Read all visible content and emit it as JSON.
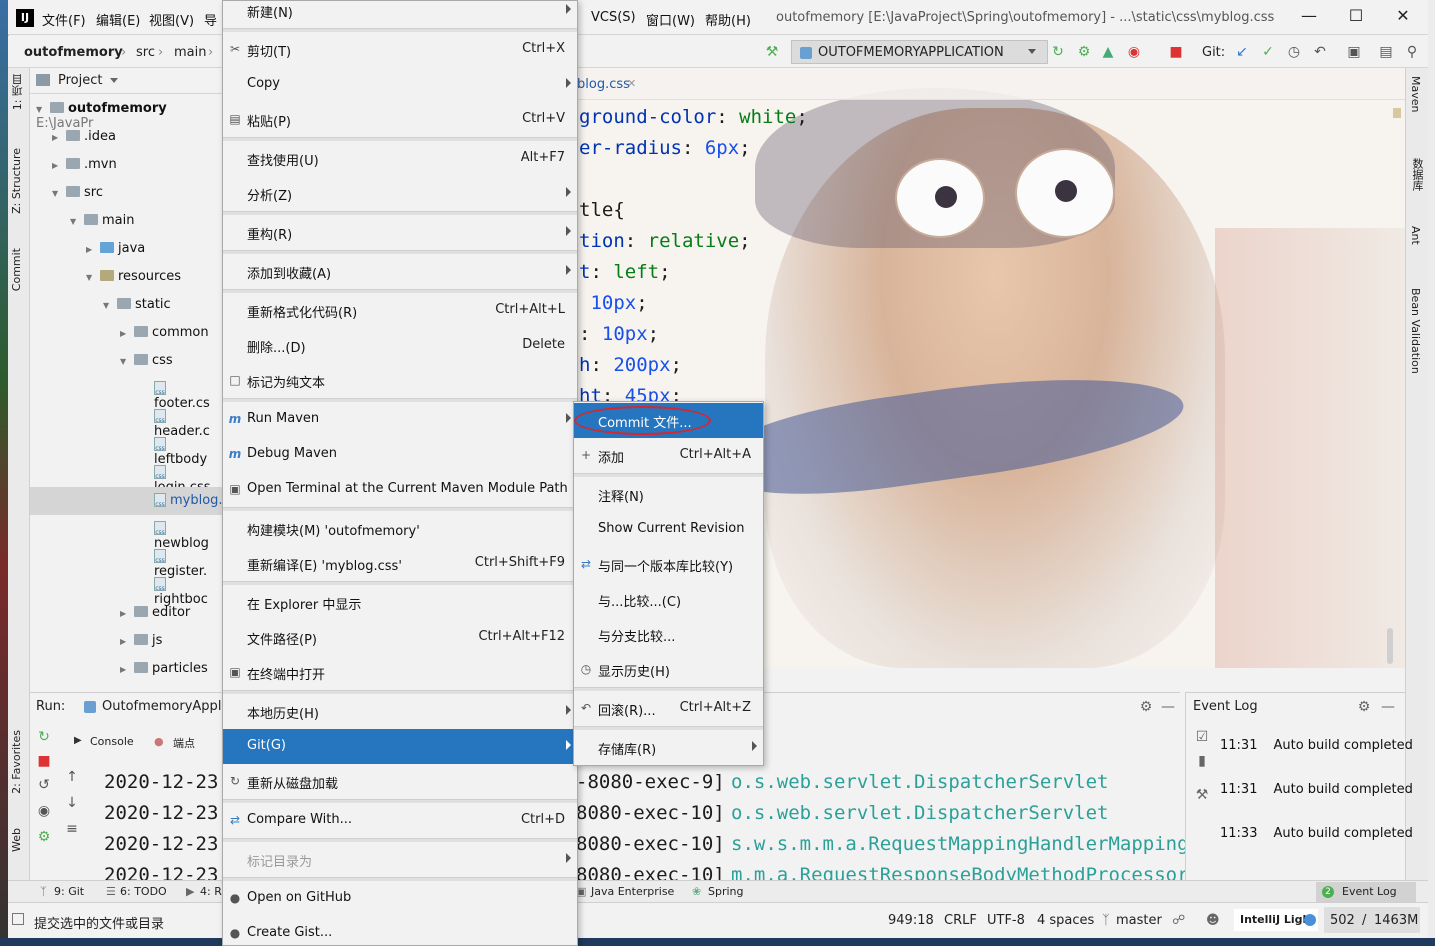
{
  "menubar": {
    "items": [
      "文件(F)",
      "编辑(E)",
      "视图(V)",
      "导",
      "VCS(S)",
      "窗口(W)",
      "帮助(H)"
    ],
    "window_title": "outofmemory [E:\\JavaProject\\Spring\\outofmemory] - ...\\static\\css\\myblog.css"
  },
  "breadcrumb": [
    "outofmemory",
    "src",
    "main"
  ],
  "run_config": "OUTOFMEMORYAPPLICATION",
  "git_label": "Git:",
  "left_tabs": [
    "1: 项目",
    "Z: Structure",
    "Commit",
    "2: Favorites",
    "Web"
  ],
  "right_tabs": [
    "Maven",
    "数据库",
    "Ant",
    "Bean Validation"
  ],
  "project": {
    "header": "Project",
    "root": "outofmemory",
    "root_path": "E:\\JavaPr",
    "tree": [
      ".idea",
      ".mvn",
      "src",
      "main",
      "java",
      "resources",
      "static",
      "common",
      "css",
      "footer.cs",
      "header.c",
      "leftbody",
      "login.css",
      "myblog.",
      "newblog",
      "register.",
      "rightboc",
      "editor",
      "js",
      "particles"
    ]
  },
  "editor": {
    "tab_label": "blog.css",
    "lines": [
      {
        "prop": "ground-color",
        "sep": ": ",
        "val": "white",
        "end": ";"
      },
      {
        "prop": "er-radius",
        "sep": ": ",
        "val": "6px",
        "end": ";"
      },
      {
        "prop": "",
        "sep": "",
        "val": "",
        "end": ""
      },
      {
        "prop": "tle{",
        "sep": "",
        "val": "",
        "end": ""
      },
      {
        "prop": "tion",
        "sep": ": ",
        "val": "relative",
        "end": ";"
      },
      {
        "prop": "t",
        "sep": ": ",
        "val": "left",
        "end": ";"
      },
      {
        "prop": "",
        "sep": " ",
        "val": "10px",
        "end": ";"
      },
      {
        "prop": "",
        "sep": ": ",
        "val": "10px",
        "end": ";"
      },
      {
        "prop": "h",
        "sep": ": ",
        "val": "200px",
        "end": ";"
      },
      {
        "prop": "ht",
        "sep": ": ",
        "val": "45px",
        "end": ";"
      }
    ]
  },
  "run_panel": {
    "label": "Run:",
    "config": "OutofmemoryAppli",
    "tabs": [
      "Console",
      "端点"
    ],
    "dates": [
      "2020-12-23",
      "2020-12-23",
      "2020-12-23",
      "2020-12-23"
    ],
    "threads": [
      "-8080-exec-9]",
      "8080-exec-10]",
      "8080-exec-10]",
      "8080-exec-10]"
    ],
    "classes": [
      "o.s.web.servlet.DispatcherServlet",
      "o.s.web.servlet.DispatcherServlet",
      "s.w.s.m.m.a.RequestMappingHandlerMapping",
      "m.m.a.RequestResponseBodyMethodProcessor"
    ]
  },
  "event_log": {
    "title": "Event Log",
    "entries": [
      {
        "time": "11:31",
        "text": "Auto build completed"
      },
      {
        "time": "11:31",
        "text": "Auto build completed"
      },
      {
        "time": "11:33",
        "text": "Auto build completed"
      }
    ]
  },
  "toolwin_bar": [
    "9: Git",
    "6: TODO",
    "4: R",
    "Java Enterprise",
    "Spring",
    "Event Log"
  ],
  "event_log_badge": "2",
  "status": {
    "message": "提交选中的文件或目录",
    "position": "949:18",
    "line_sep": "CRLF",
    "encoding": "UTF-8",
    "indent": "4 spaces",
    "branch": "master",
    "theme": "IntelliJ Light",
    "memory_used": "502",
    "memory_total": "1463M"
  },
  "context_menu": [
    {
      "label": "新建(N)",
      "shortcut": "",
      "sub": true,
      "icon": ""
    },
    {
      "sep": true
    },
    {
      "label": "剪切(T)",
      "shortcut": "Ctrl+X",
      "sub": false,
      "icon": "scissors-icon"
    },
    {
      "label": "Copy",
      "shortcut": "",
      "sub": true,
      "icon": ""
    },
    {
      "label": "粘贴(P)",
      "shortcut": "Ctrl+V",
      "sub": false,
      "icon": "clipboard-icon"
    },
    {
      "sep": true
    },
    {
      "label": "查找使用(U)",
      "shortcut": "Alt+F7",
      "sub": false,
      "icon": ""
    },
    {
      "label": "分析(Z)",
      "shortcut": "",
      "sub": true,
      "icon": ""
    },
    {
      "sep": true
    },
    {
      "label": "重构(R)",
      "shortcut": "",
      "sub": true,
      "icon": ""
    },
    {
      "sep": true
    },
    {
      "label": "添加到收藏(A)",
      "shortcut": "",
      "sub": true,
      "icon": ""
    },
    {
      "sep": true
    },
    {
      "label": "重新格式化代码(R)",
      "shortcut": "Ctrl+Alt+L",
      "sub": false,
      "icon": ""
    },
    {
      "label": "删除...(D)",
      "shortcut": "Delete",
      "sub": false,
      "icon": ""
    },
    {
      "label": "标记为纯文本",
      "shortcut": "",
      "sub": false,
      "icon": "text-file-icon"
    },
    {
      "sep": true
    },
    {
      "label": "Run Maven",
      "shortcut": "",
      "sub": true,
      "icon": "maven-icon"
    },
    {
      "label": "Debug Maven",
      "shortcut": "",
      "sub": false,
      "icon": "maven-icon"
    },
    {
      "label": "Open Terminal at the Current Maven Module Path",
      "shortcut": "",
      "sub": false,
      "icon": "terminal-icon"
    },
    {
      "sep": true
    },
    {
      "label": "构建模块(M) 'outofmemory'",
      "shortcut": "",
      "sub": false,
      "icon": ""
    },
    {
      "label": "重新编译(E) 'myblog.css'",
      "shortcut": "Ctrl+Shift+F9",
      "sub": false,
      "icon": ""
    },
    {
      "sep": true
    },
    {
      "label": "在 Explorer 中显示",
      "shortcut": "",
      "sub": false,
      "icon": ""
    },
    {
      "label": "文件路径(P)",
      "shortcut": "Ctrl+Alt+F12",
      "sub": false,
      "icon": ""
    },
    {
      "label": "在终端中打开",
      "shortcut": "",
      "sub": false,
      "icon": "terminal-icon"
    },
    {
      "sep": true
    },
    {
      "label": "本地历史(H)",
      "shortcut": "",
      "sub": true,
      "icon": ""
    },
    {
      "label": "Git(G)",
      "shortcut": "",
      "sub": true,
      "icon": "",
      "highlight": true
    },
    {
      "label": "重新从磁盘加载",
      "shortcut": "",
      "sub": false,
      "icon": "reload-icon"
    },
    {
      "sep": true
    },
    {
      "label": "Compare With...",
      "shortcut": "Ctrl+D",
      "sub": false,
      "icon": "compare-icon"
    },
    {
      "sep": true
    },
    {
      "label": "标记目录为",
      "shortcut": "",
      "sub": true,
      "icon": "",
      "disabled": true
    },
    {
      "sep": true
    },
    {
      "label": "Open on GitHub",
      "shortcut": "",
      "sub": false,
      "icon": "github-icon"
    },
    {
      "label": "Create Gist...",
      "shortcut": "",
      "sub": false,
      "icon": "github-icon"
    }
  ],
  "git_menu": [
    {
      "label": "Commit 文件...",
      "shortcut": "",
      "sub": false,
      "icon": "",
      "highlight": true
    },
    {
      "label": "添加",
      "shortcut": "Ctrl+Alt+A",
      "sub": false,
      "icon": "plus-icon"
    },
    {
      "sep": true
    },
    {
      "label": "注释(N)",
      "shortcut": "",
      "sub": false,
      "icon": ""
    },
    {
      "label": "Show Current Revision",
      "shortcut": "",
      "sub": false,
      "icon": ""
    },
    {
      "label": "与同一个版本库比较(Y)",
      "shortcut": "",
      "sub": false,
      "icon": "compare-icon"
    },
    {
      "label": "与...比较...(C)",
      "shortcut": "",
      "sub": false,
      "icon": ""
    },
    {
      "label": "与分支比较...",
      "shortcut": "",
      "sub": false,
      "icon": ""
    },
    {
      "label": "显示历史(H)",
      "shortcut": "",
      "sub": false,
      "icon": "history-icon"
    },
    {
      "sep": true
    },
    {
      "label": "回滚(R)...",
      "shortcut": "Ctrl+Alt+Z",
      "sub": false,
      "icon": "rollback-icon"
    },
    {
      "sep": true
    },
    {
      "label": "存储库(R)",
      "shortcut": "",
      "sub": true,
      "icon": ""
    }
  ],
  "colors": {
    "highlight": "#2675bf",
    "annotation": "#d8262b",
    "keyword": "#0033b3",
    "value": "#067d17",
    "number": "#1750eb"
  }
}
